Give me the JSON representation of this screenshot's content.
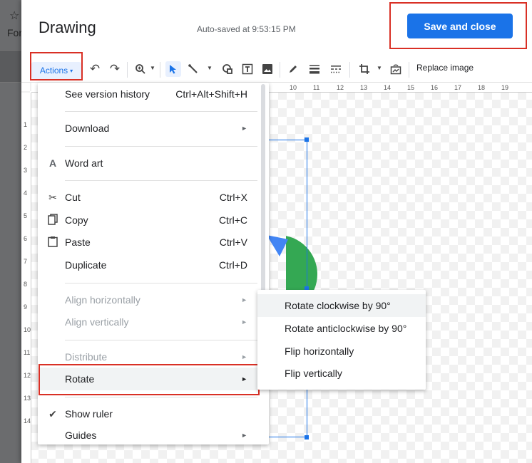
{
  "background": {
    "star_glyph": "☆",
    "partial_text": "For"
  },
  "dialog": {
    "title": "Drawing",
    "autosave": "Auto-saved at 9:53:15 PM",
    "save_label": "Save and close"
  },
  "toolbar": {
    "actions_label": "Actions",
    "replace_image_label": "Replace image",
    "icons": [
      "undo-icon",
      "redo-icon",
      "zoom-icon",
      "select-icon",
      "line-icon",
      "shape-icon",
      "textbox-icon",
      "image-icon",
      "pen-icon",
      "line-weight-icon",
      "line-dash-icon",
      "crop-icon",
      "reset-image-icon"
    ]
  },
  "ruler": {
    "top": [
      "10",
      "11",
      "12",
      "13",
      "14",
      "15",
      "16",
      "17",
      "18",
      "19"
    ],
    "left": [
      "1",
      "2",
      "3",
      "4",
      "5",
      "6",
      "7",
      "8",
      "9",
      "10",
      "11",
      "12",
      "13",
      "14"
    ]
  },
  "menu": {
    "items": [
      {
        "label": "See version history",
        "shortcut": "Ctrl+Alt+Shift+H"
      },
      {
        "label": "Download",
        "arrow": "►"
      },
      {
        "label": "Word art",
        "icon": "word-art-icon"
      },
      {
        "label": "Cut",
        "shortcut": "Ctrl+X",
        "icon": "scissors-icon"
      },
      {
        "label": "Copy",
        "shortcut": "Ctrl+C",
        "icon": "copy-icon"
      },
      {
        "label": "Paste",
        "shortcut": "Ctrl+V",
        "icon": "clipboard-icon"
      },
      {
        "label": "Duplicate",
        "shortcut": "Ctrl+D"
      },
      {
        "label": "Align horizontally",
        "arrow": "►",
        "disabled": true
      },
      {
        "label": "Align vertically",
        "arrow": "►",
        "disabled": true
      },
      {
        "label": "Distribute",
        "arrow": "►",
        "disabled": true
      },
      {
        "label": "Rotate",
        "arrow": "►",
        "highlighted": true
      },
      {
        "label": "Show ruler",
        "icon": "checkmark-icon"
      },
      {
        "label": "Guides",
        "arrow": "►"
      }
    ]
  },
  "submenu": {
    "items": [
      {
        "label": "Rotate clockwise by 90°"
      },
      {
        "label": "Rotate anticlockwise by 90°"
      },
      {
        "label": "Flip horizontally"
      },
      {
        "label": "Flip vertically"
      }
    ]
  },
  "colors": {
    "accent": "#1a73e8",
    "highlight_box": "#d93025",
    "shape_green": "#34a853",
    "shape_blue": "#4285f4"
  }
}
